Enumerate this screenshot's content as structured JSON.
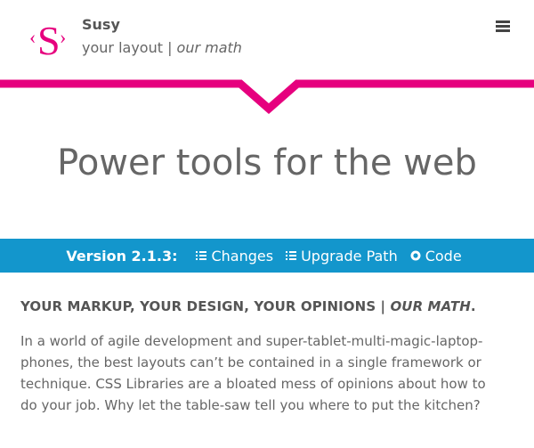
{
  "brand": {
    "logo_letter": "S",
    "name": "Susy",
    "tagline_prefix": "your layout | ",
    "tagline_emphasis": "our math"
  },
  "nav": {
    "menu_icon": "hamburger-menu-icon"
  },
  "hero": {
    "title": "Power tools for the web"
  },
  "version_bar": {
    "label": "Version 2.1.3:",
    "links": [
      {
        "label": "Changes",
        "icon": "list-icon"
      },
      {
        "label": "Upgrade Path",
        "icon": "list-icon"
      },
      {
        "label": "Code",
        "icon": "github-icon"
      }
    ]
  },
  "intro": {
    "heading_prefix": "YOUR MARKUP, YOUR DESIGN, YOUR OPINIONS | ",
    "heading_emphasis": "OUR MATH",
    "heading_suffix": ".",
    "paragraph": "In a world of agile development and super-tablet-multi-magic-laptop-phones, the best layouts can’t be contained in a single framework or technique. CSS Libraries are a bloated mess of opinions about how to do your job. Why let the table-saw tell you where to put the kitchen?"
  },
  "colors": {
    "accent": "#e6007e",
    "bar": "#1396cc"
  }
}
